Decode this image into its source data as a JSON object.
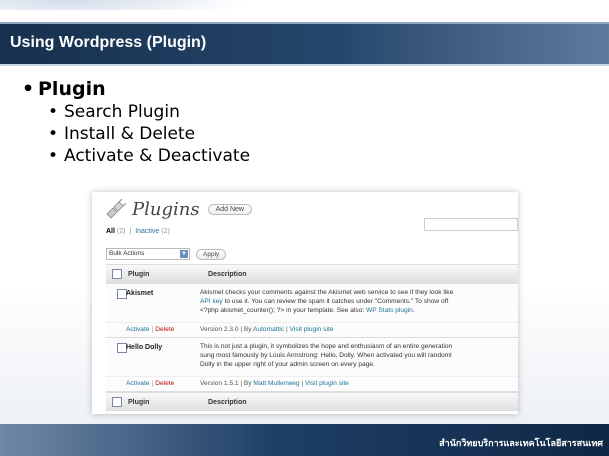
{
  "slide": {
    "title": "Using Wordpress (Plugin)",
    "main_bullet": "Plugin",
    "sub_bullets": [
      "Search Plugin",
      "Install & Delete",
      "Activate & Deactivate"
    ],
    "footer": "สำนักวิทยบริการและเทคโนโลยีสารสนเทศ",
    "colors": {
      "title_bar": "#1f3f66",
      "footer": "#0f2745"
    }
  },
  "wp": {
    "page_title": "Plugins",
    "add_new": "Add New",
    "filter_all": "All",
    "filter_all_count": "(2)",
    "filter_sep": "|",
    "filter_inactive": "Inactive",
    "filter_inactive_count": "(2)",
    "bulk_actions": "Bulk Actions",
    "apply": "Apply",
    "col_plugin": "Plugin",
    "col_description": "Description",
    "plugins": [
      {
        "name": "Akismet",
        "desc_line1": "Akismet checks your comments against the Akismet web service to see if they look like",
        "desc_link1": "API key",
        "desc_line2": " to use it. You can review the spam it catches under \"Comments.\" To show off",
        "desc_line3a": "<?php akismet_counter(); ?> in your template. See also: ",
        "desc_link2": "WP Stats plugin",
        "desc_line3b": ".",
        "activate": "Activate",
        "delete": "Delete",
        "version_text": "Version 2.3.0 | By ",
        "author": "Automattic",
        "visit_sep": " | ",
        "visit": "Visit plugin site"
      },
      {
        "name": "Hello Dolly",
        "desc_line1": "This is not just a plugin, it symbolizes the hope and enthusiasm of an entire generation",
        "desc_line2": "sung most famously by Louis Armstrong: Hello, Dolly. When activated you will randoml",
        "desc_line3": "Dolly in the upper right of your admin screen on every page.",
        "activate": "Activate",
        "delete": "Delete",
        "version_text": "Version 1.5.1 | By ",
        "author": "Matt Mullenweg",
        "visit_sep": " | ",
        "visit": "Visit plugin site"
      }
    ]
  }
}
